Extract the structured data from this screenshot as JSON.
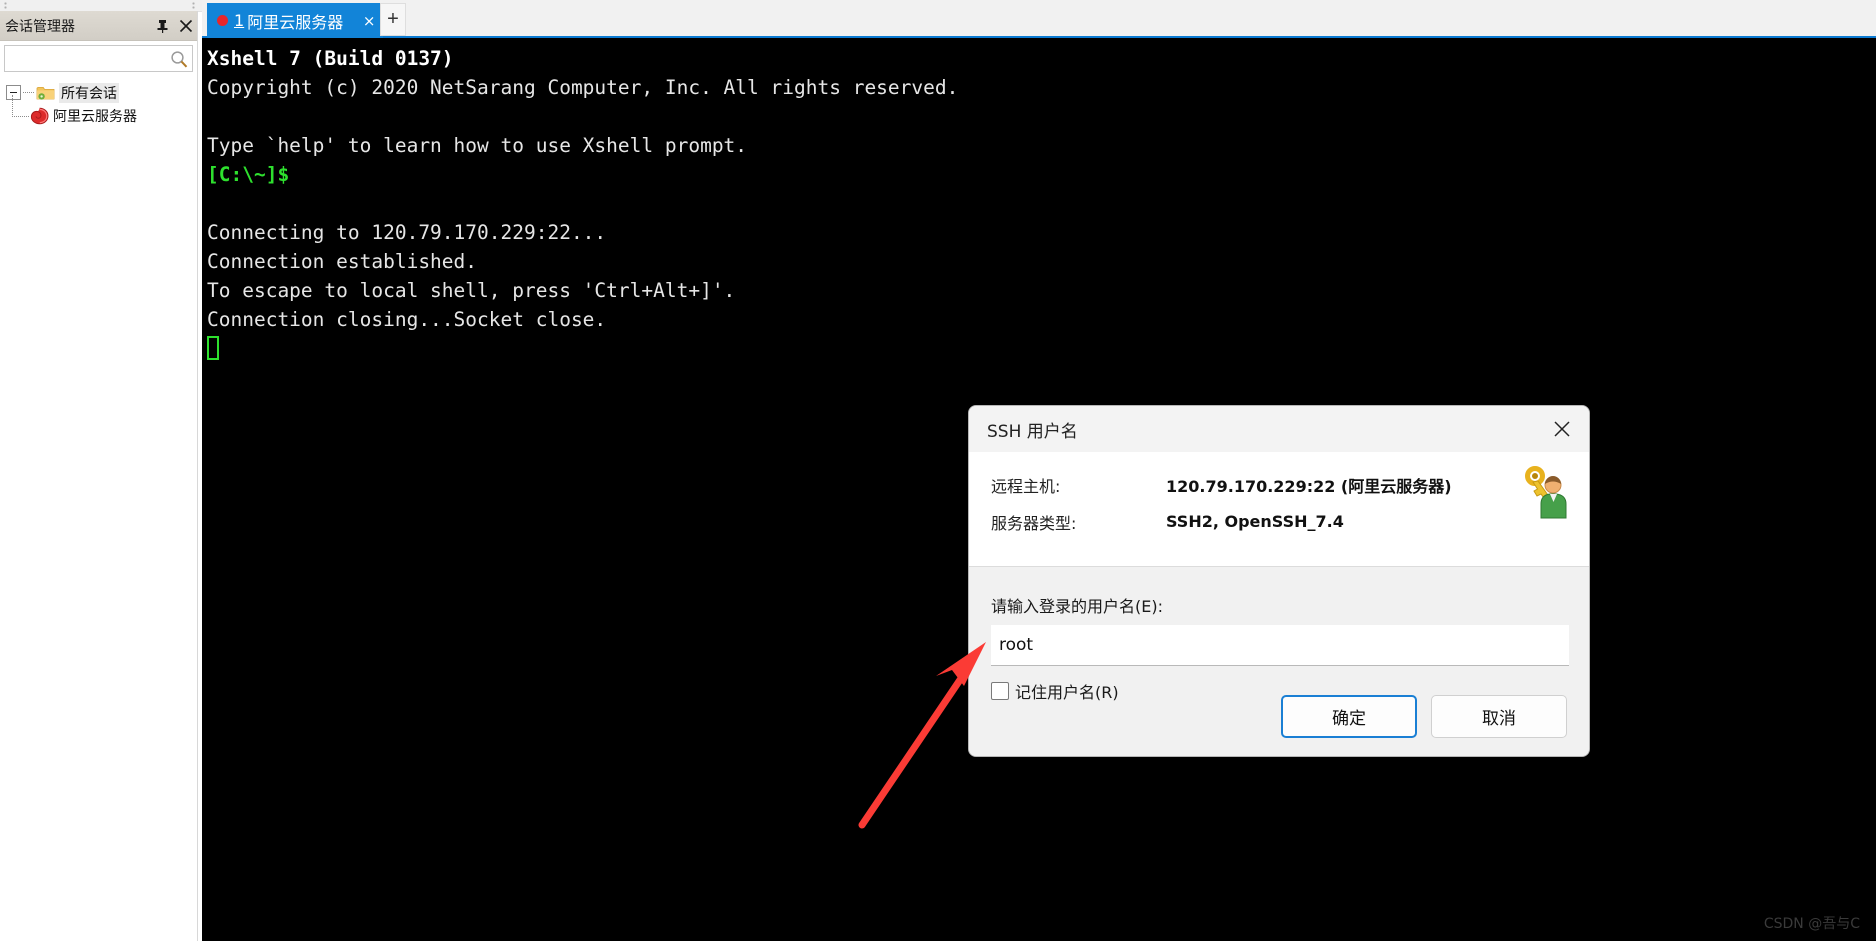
{
  "sidebar": {
    "panel_title": "会话管理器",
    "pin_icon": "pin-icon",
    "close_icon": "close-icon",
    "search": {
      "value": "",
      "placeholder": "",
      "icon": "search-icon"
    },
    "tree": {
      "root_label": "所有会话",
      "root_icon": "folder-icon",
      "children": [
        {
          "label": "阿里云服务器",
          "icon": "xshell-session-icon"
        }
      ]
    }
  },
  "tabbar": {
    "tabs": [
      {
        "status_dot": "red-status-dot",
        "index": "1",
        "title": "阿里云服务器",
        "close_label": "×"
      }
    ],
    "new_tab_label": "+"
  },
  "terminal": {
    "lines": [
      "Xshell 7 (Build 0137)",
      "Copyright (c) 2020 NetSarang Computer, Inc. All rights reserved.",
      "",
      "Type `help' to learn how to use Xshell prompt.",
      "[C:\\~]$",
      "",
      "Connecting to 120.79.170.229:22...",
      "Connection established.",
      "To escape to local shell, press 'Ctrl+Alt+]'.",
      "Connection closing...Socket close."
    ],
    "line0": "Xshell 7 (Build 0137)",
    "line1": "Copyright (c) 2020 NetSarang Computer, Inc. All rights reserved.",
    "line3": "Type `help' to learn how to use Xshell prompt.",
    "line4": "[C:\\~]$",
    "line6": "Connecting to 120.79.170.229:22...",
    "line7": "Connection established.",
    "line8": "To escape to local shell, press 'Ctrl+Alt+]'.",
    "line9": "Connection closing...Socket close.",
    "cursor": "block-cursor"
  },
  "dialog": {
    "title": "SSH 用户名",
    "close_icon": "close-icon",
    "info": [
      {
        "label": "远程主机:",
        "value": "120.79.170.229:22 (阿里云服务器)"
      },
      {
        "label": "服务器类型:",
        "value": "SSH2, OpenSSH_7.4"
      }
    ],
    "icon": "key-and-user-icon",
    "prompt_label": "请输入登录的用户名(E):",
    "username": {
      "value": "root",
      "placeholder": ""
    },
    "remember": {
      "label": "记住用户名(R)",
      "checked": false
    },
    "buttons": {
      "ok": "确定",
      "cancel": "取消"
    }
  },
  "annotation": {
    "arrow": "red-arrow",
    "color": "#fb3b35"
  },
  "watermark": "CSDN @吾与C",
  "colors": {
    "tab_active": "#1284d8",
    "terminal_bg": "#000000",
    "terminal_fg": "#e6e6e6",
    "prompt_green": "#2ee02e",
    "accent_blue": "#1a7fd4",
    "annotation_red": "#fb3b35"
  }
}
